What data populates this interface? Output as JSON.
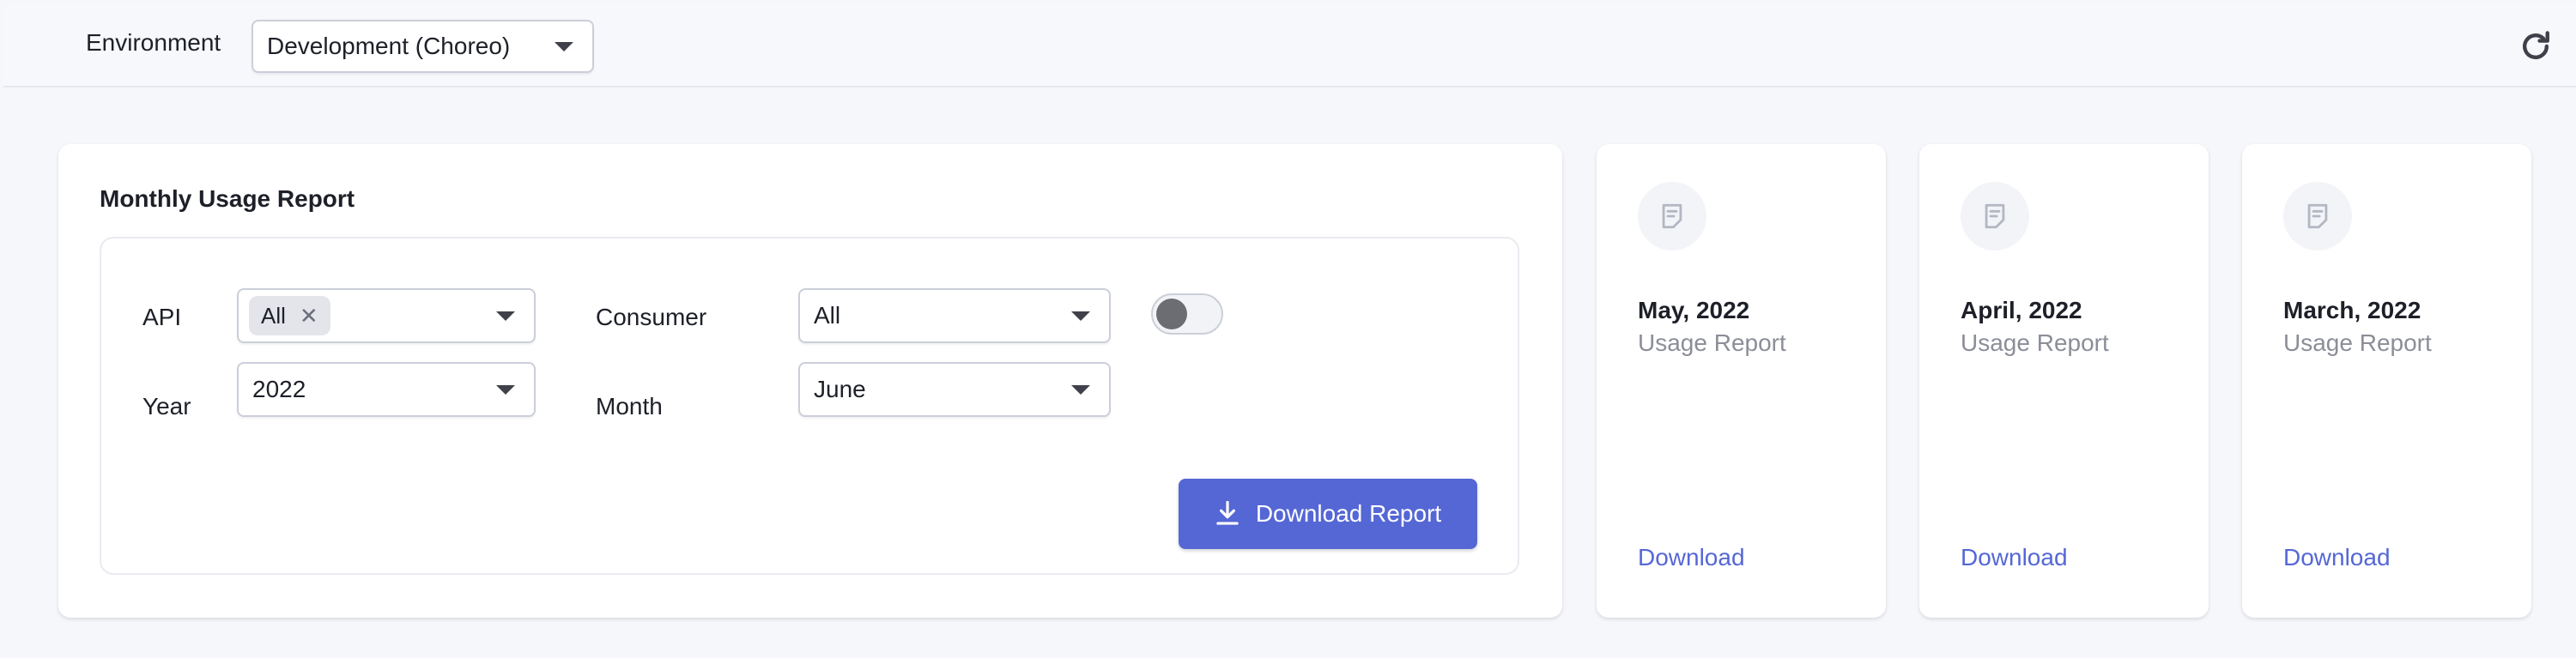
{
  "header": {
    "environment_label": "Environment",
    "environment_value": "Development (Choreo)",
    "refresh_icon": "refresh-icon"
  },
  "main": {
    "title": "Monthly Usage Report",
    "api_label": "API",
    "api_chip": "All",
    "consumer_label": "Consumer",
    "consumer_value": "All",
    "year_label": "Year",
    "year_value": "2022",
    "month_label": "Month",
    "month_value": "June",
    "download_button": "Download Report",
    "toggle_on": false,
    "accent_color": "#5567d5"
  },
  "reports": [
    {
      "month": "May, 2022",
      "subtitle": "Usage Report",
      "link": "Download",
      "icon": "document-icon"
    },
    {
      "month": "April, 2022",
      "subtitle": "Usage Report",
      "link": "Download",
      "icon": "document-icon"
    },
    {
      "month": "March, 2022",
      "subtitle": "Usage Report",
      "link": "Download",
      "icon": "document-icon"
    }
  ]
}
